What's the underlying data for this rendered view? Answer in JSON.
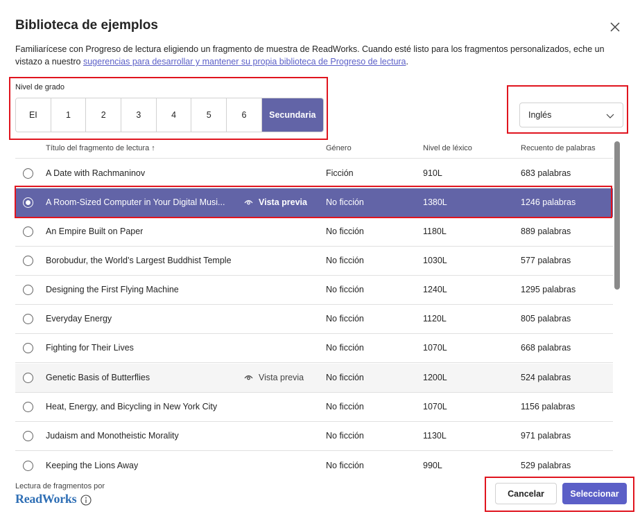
{
  "dialog": {
    "title": "Biblioteca de ejemplos",
    "intro_text": "Familiarícese con Progreso de lectura eligiendo un fragmento de muestra de ReadWorks. Cuando esté listo para los fragmentos personalizados, eche un vistazo a nuestro ",
    "intro_link": "sugerencias para desarrollar y mantener su propia biblioteca de Progreso de lectura",
    "intro_end": "."
  },
  "grade": {
    "label": "Nivel de grado",
    "options": [
      "EI",
      "1",
      "2",
      "3",
      "4",
      "5",
      "6",
      "Secundaria"
    ],
    "selected": "Secundaria"
  },
  "language": {
    "selected": "Inglés"
  },
  "table": {
    "headers": {
      "title": "Título del fragmento de lectura",
      "title_sort": "↑",
      "genre": "Género",
      "lexile": "Nivel de léxico",
      "words": "Recuento de palabras"
    },
    "preview_label": "Vista previa",
    "rows": [
      {
        "title": "A Date with Rachmaninov",
        "genre": "Ficción",
        "lexile": "910L",
        "words": "683 palabras"
      },
      {
        "title": "A Room-Sized Computer in Your Digital Musi...",
        "genre": "No ficción",
        "lexile": "1380L",
        "words": "1246 palabras"
      },
      {
        "title": "An Empire Built on Paper",
        "genre": "No ficción",
        "lexile": "1180L",
        "words": "889 palabras"
      },
      {
        "title": "Borobudur, the World’s Largest Buddhist Temple",
        "genre": "No ficción",
        "lexile": "1030L",
        "words": "577 palabras"
      },
      {
        "title": "Designing the First Flying Machine",
        "genre": "No ficción",
        "lexile": "1240L",
        "words": "1295 palabras"
      },
      {
        "title": "Everyday Energy",
        "genre": "No ficción",
        "lexile": "1120L",
        "words": "805 palabras"
      },
      {
        "title": "Fighting for Their Lives",
        "genre": "No ficción",
        "lexile": "1070L",
        "words": "668 palabras"
      },
      {
        "title": "Genetic Basis of Butterflies",
        "genre": "No ficción",
        "lexile": "1200L",
        "words": "524 palabras"
      },
      {
        "title": "Heat, Energy, and Bicycling in New York City",
        "genre": "No ficción",
        "lexile": "1070L",
        "words": "1156 palabras"
      },
      {
        "title": "Judaism and Monotheistic Morality",
        "genre": "No ficción",
        "lexile": "1130L",
        "words": "971 palabras"
      },
      {
        "title": "Keeping the Lions Away",
        "genre": "No ficción",
        "lexile": "990L",
        "words": "529 palabras"
      }
    ]
  },
  "footer": {
    "attribution": "Lectura de fragmentos por",
    "logo": "ReadWorks",
    "cancel": "Cancelar",
    "select": "Seleccionar"
  },
  "colors": {
    "accent": "#6264a7",
    "primary_button": "#5b5fc7",
    "highlight_outline": "#e0141e",
    "logo": "#2f6fb5"
  },
  "icons": [
    "close-icon",
    "chevron-down-icon",
    "eye-icon",
    "info-icon",
    "sort-arrow-up-icon"
  ]
}
